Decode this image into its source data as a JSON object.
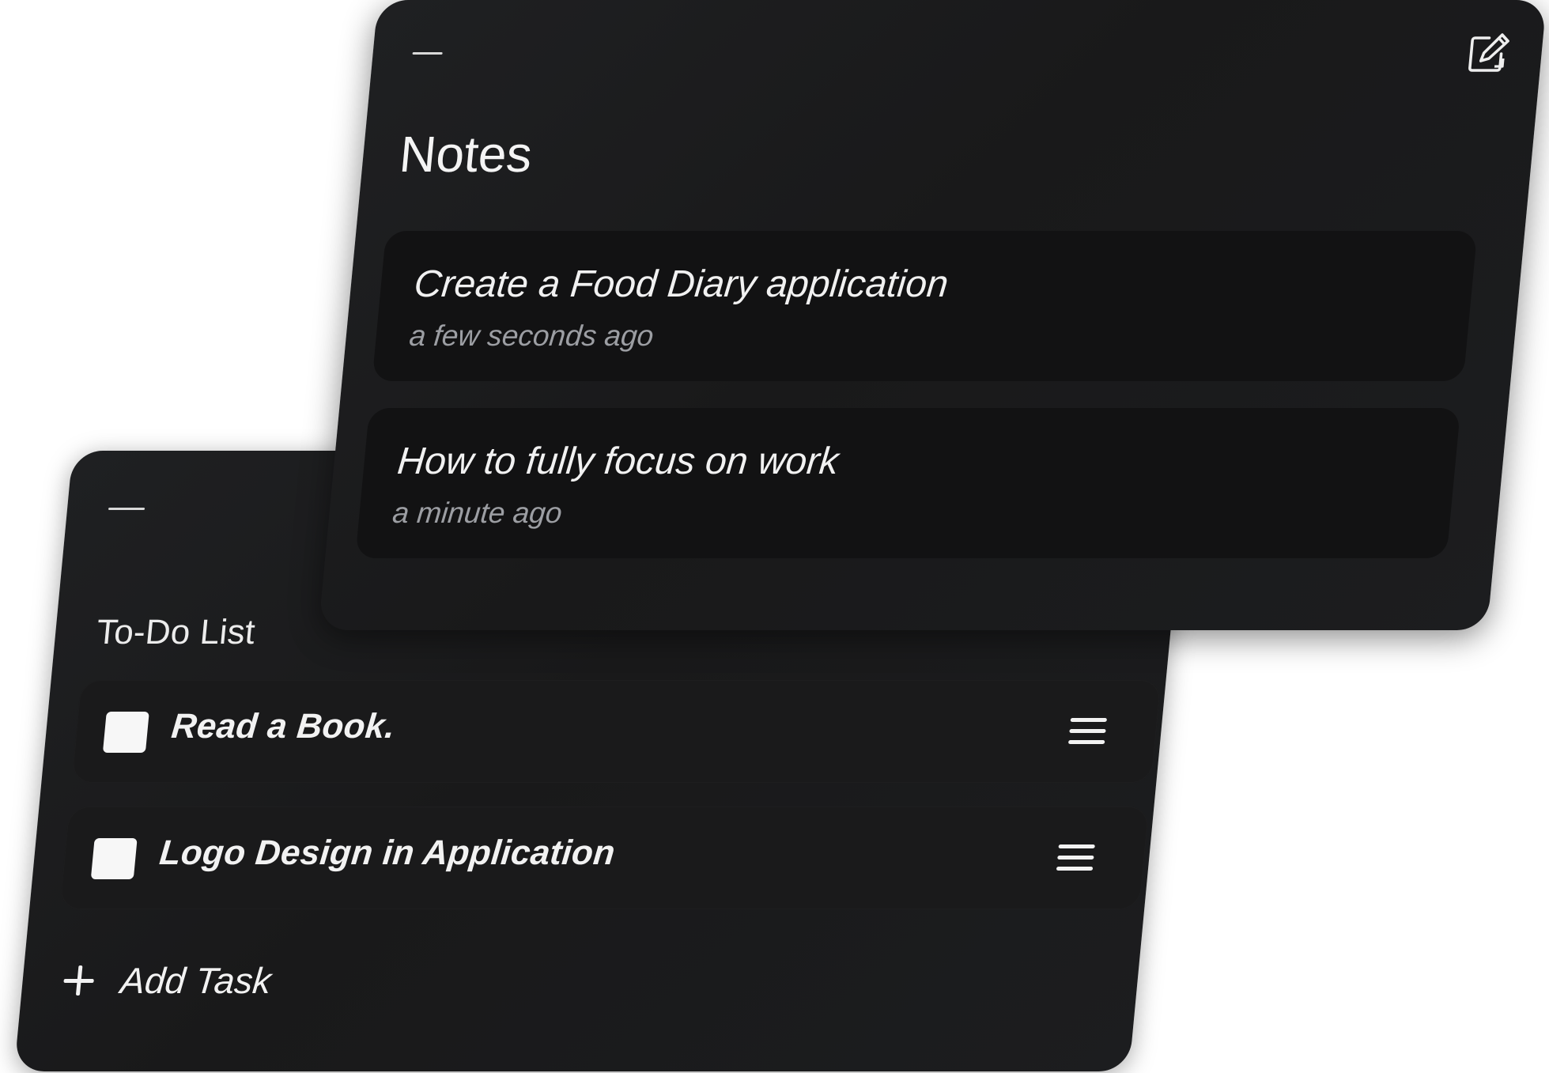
{
  "todo": {
    "title": "To-Do List",
    "items": [
      {
        "label": "Read a Book."
      },
      {
        "label": "Logo Design in Application"
      }
    ],
    "add_label": "Add Task"
  },
  "notes": {
    "title": "Notes",
    "items": [
      {
        "title": "Create a Food Diary application",
        "time": "a few seconds ago"
      },
      {
        "title": "How to fully focus on work",
        "time": "a minute ago"
      }
    ]
  },
  "icons": {
    "minimize": "minimize-icon",
    "compose": "compose-icon",
    "checkbox": "checkbox-icon",
    "drag_handle": "drag-handle-icon",
    "add": "plus-icon"
  },
  "colors": {
    "panel_bg": "#1c1c1d",
    "item_bg": "#1a1a1b",
    "note_item_bg": "#121213",
    "text_primary": "#f2f2f2",
    "text_muted": "#9c9ea3",
    "checkbox": "#f7f7f7"
  }
}
